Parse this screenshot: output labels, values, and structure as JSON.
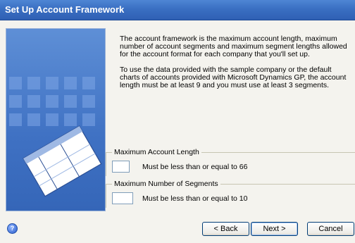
{
  "window": {
    "title": "Set Up Account Framework"
  },
  "intro": {
    "paragraph1": "The account framework is the maximum account length, maximum number of account segments and maximum segment lengths allowed for the account format for each company that you'll set up.",
    "paragraph2": "To use the data provided with the sample company or the default charts of accounts provided with Microsoft Dynamics GP, the account length must be at least 9 and you must use at least 3 segments."
  },
  "account_length": {
    "label": "Maximum Account Length",
    "value": "",
    "hint": "Must be less than or equal to 66"
  },
  "segments": {
    "label": "Maximum Number of Segments",
    "value": "",
    "hint": "Must be less than or equal to 10"
  },
  "buttons": {
    "back": "< Back",
    "next": "Next >",
    "cancel": "Cancel"
  },
  "help": {
    "glyph": "?"
  },
  "colors": {
    "title_bar": "#3a6fc2",
    "side_panel": "#3f71c3"
  }
}
